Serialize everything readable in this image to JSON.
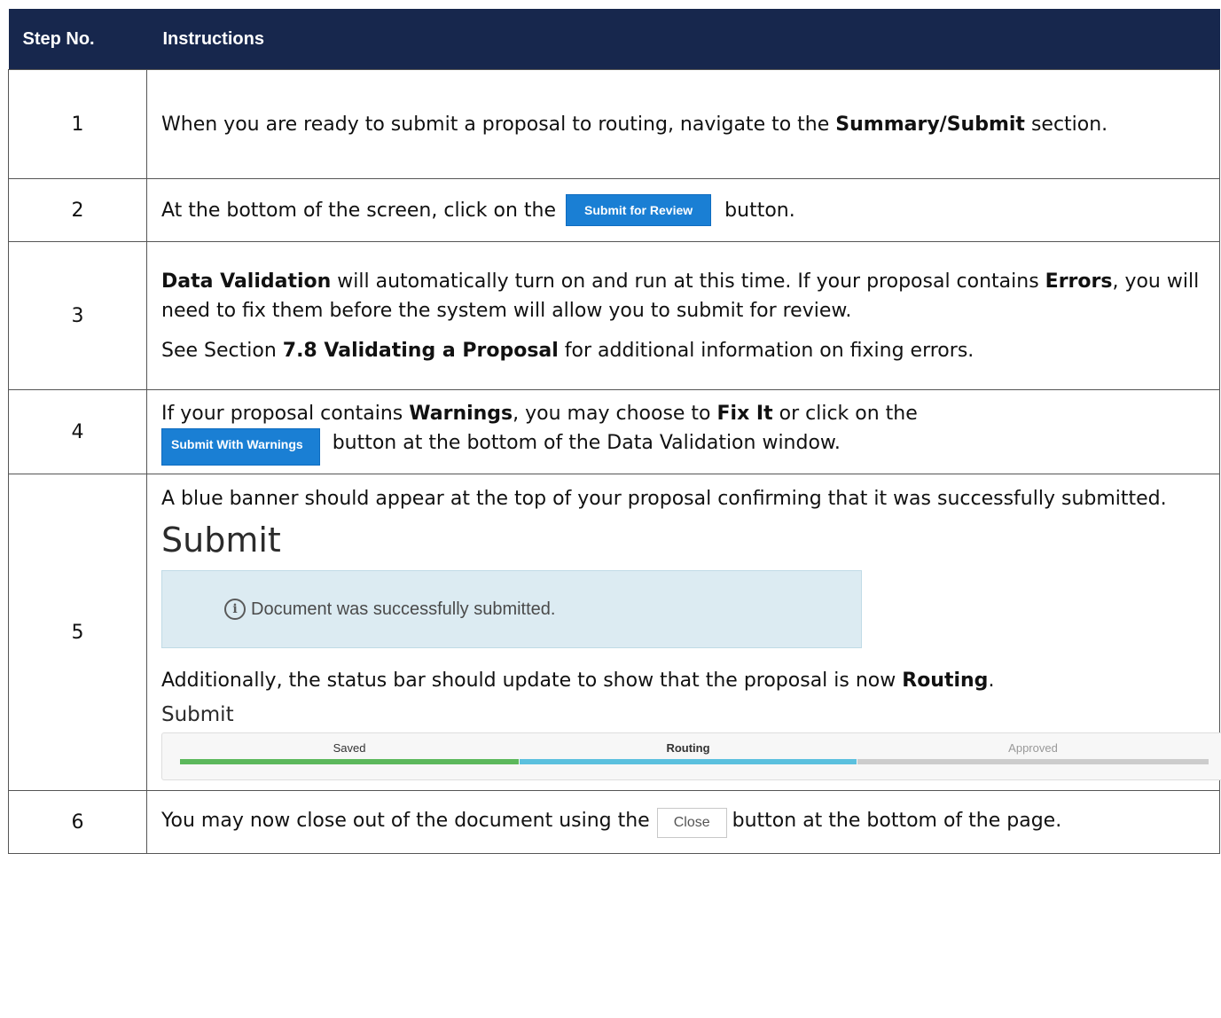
{
  "header": {
    "step_col": "Step No.",
    "instructions_col": "Instructions"
  },
  "colors": {
    "header_bg": "#17274d",
    "button_blue": "#1a7fd4",
    "saved": "#5cb85c",
    "routing": "#5bc0de",
    "approved": "#cccccc"
  },
  "rows": [
    {
      "num": "1",
      "text_a": "When you are ready to submit a proposal to routing, navigate to the ",
      "bold_a": "Summary/Submit",
      "text_b": " section."
    },
    {
      "num": "2",
      "text_a": "At the bottom of the screen, click on the",
      "button": "Submit for Review",
      "text_b": "button."
    },
    {
      "num": "3",
      "bold_a": "Data Validation",
      "text_a": " will automatically turn on and run at this time. If your proposal contains ",
      "bold_b": "Errors",
      "text_b": ", you will need to fix them before the system will allow you to submit for review.",
      "text_c": "See Section ",
      "bold_c": "7.8 Validating a Proposal",
      "text_d": " for additional information on fixing errors."
    },
    {
      "num": "4",
      "text_a": "If your proposal contains ",
      "bold_a": "Warnings",
      "text_b": ", you may choose to ",
      "bold_b": "Fix It",
      "text_c": " or click on the",
      "button": "Submit With Warnings",
      "text_d": "button at the bottom of the Data Validation window."
    },
    {
      "num": "5",
      "text_a": "A blue banner should appear at the top of your proposal confirming that it was successfully submitted.",
      "submit_heading": "Submit",
      "info_glyph": "i",
      "banner_text": "Document was successfully submitted.",
      "text_b": "Additionally, the status bar should update to show that the proposal is now ",
      "bold_b": "Routing",
      "text_c": ".",
      "status_heading": "Submit",
      "status": {
        "saved": "Saved",
        "routing": "Routing",
        "approved": "Approved"
      }
    },
    {
      "num": "6",
      "text_a": "You may now close out of the document using the",
      "button": "Close",
      "text_b": "button at the bottom of the page."
    }
  ]
}
